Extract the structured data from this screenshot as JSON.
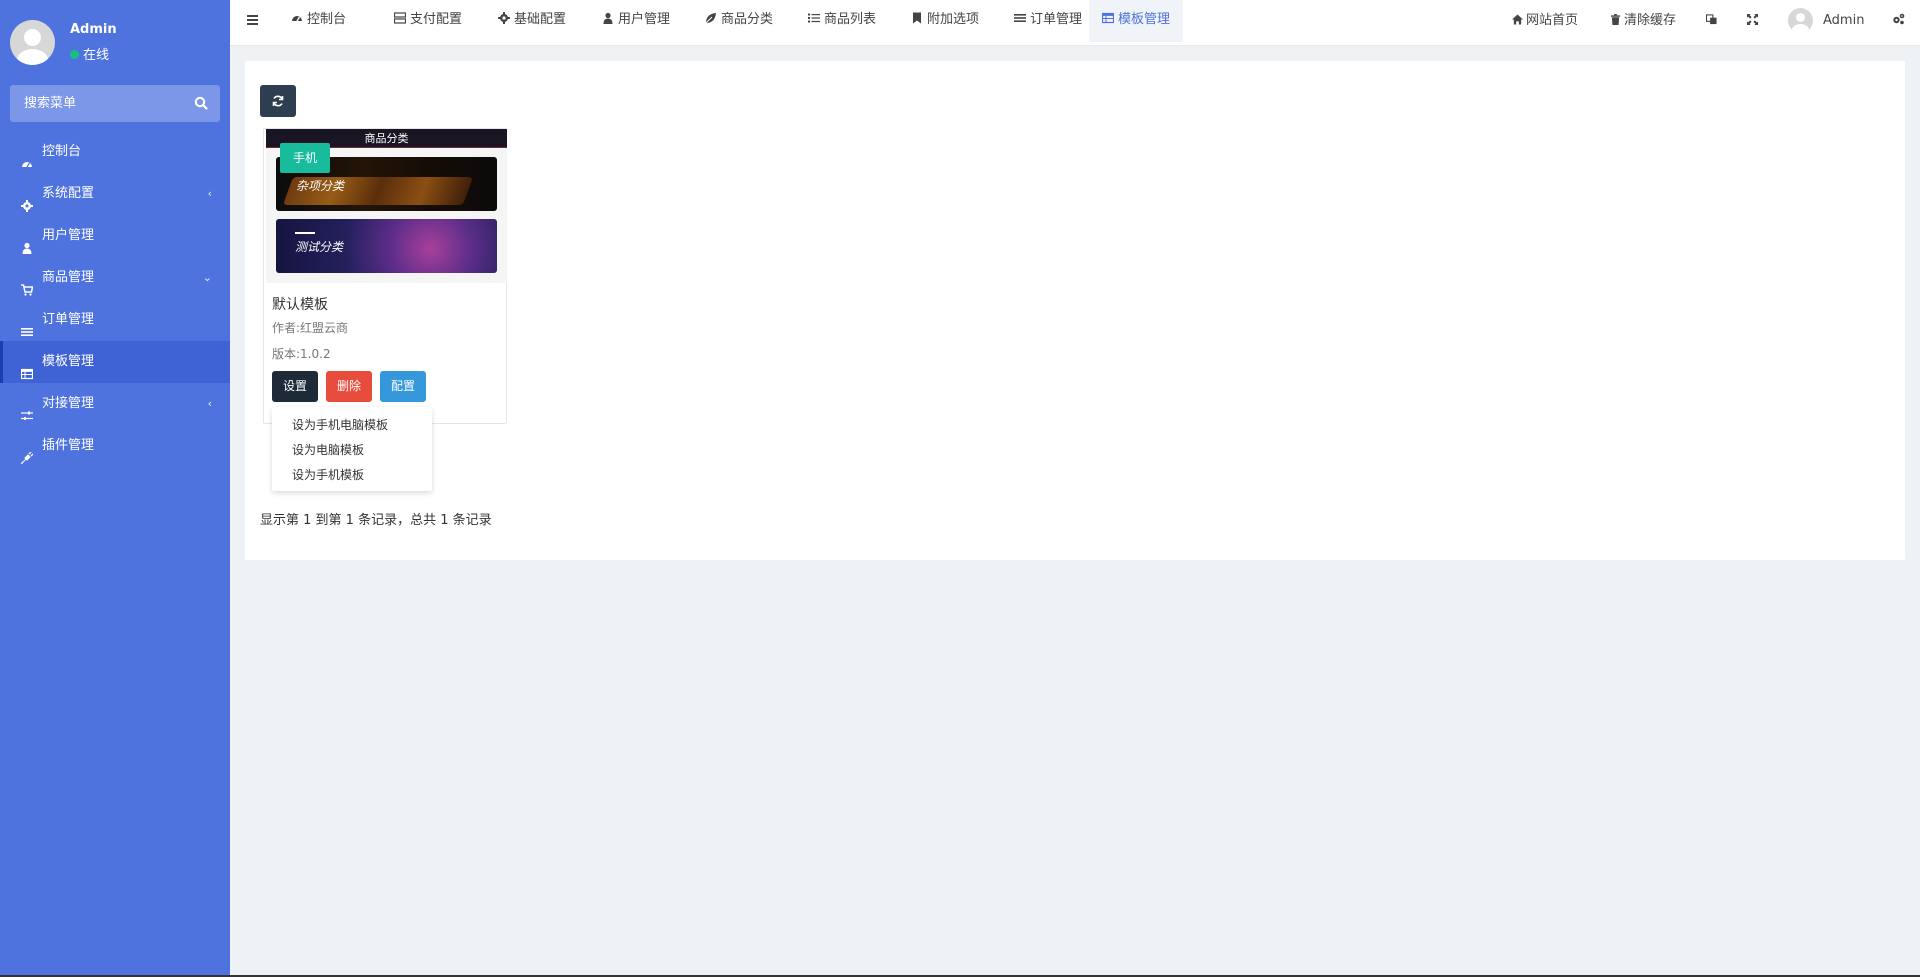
{
  "sidebar": {
    "user": {
      "name": "Admin",
      "status": "在线"
    },
    "search": {
      "placeholder": "搜索菜单"
    },
    "items": [
      {
        "label": "控制台",
        "icon": "dashboard-icon"
      },
      {
        "label": "系统配置",
        "icon": "gear-icon",
        "chevron": "‹"
      },
      {
        "label": "用户管理",
        "icon": "user-icon"
      },
      {
        "label": "商品管理",
        "icon": "cart-icon",
        "chevron": "⌄"
      },
      {
        "label": "订单管理",
        "icon": "list-icon"
      },
      {
        "label": "模板管理",
        "icon": "table-icon",
        "active": true
      },
      {
        "label": "对接管理",
        "icon": "sliders-icon",
        "chevron": "‹"
      },
      {
        "label": "插件管理",
        "icon": "plug-icon"
      }
    ]
  },
  "topnav": {
    "tabs": [
      {
        "label": "控制台",
        "icon": "dashboard-icon"
      },
      {
        "label": "支付配置",
        "icon": "server-icon"
      },
      {
        "label": "基础配置",
        "icon": "gear-icon"
      },
      {
        "label": "用户管理",
        "icon": "user-icon"
      },
      {
        "label": "商品分类",
        "icon": "leaf-icon"
      },
      {
        "label": "商品列表",
        "icon": "list-ul-icon"
      },
      {
        "label": "附加选项",
        "icon": "bookmark-icon"
      },
      {
        "label": "订单管理",
        "icon": "bars-icon"
      },
      {
        "label": "模板管理",
        "icon": "table-icon",
        "active": true
      }
    ],
    "right": {
      "home": "网站首页",
      "clear_cache": "清除缓存",
      "admin": "Admin"
    }
  },
  "content": {
    "card": {
      "thumb_header": "商品分类",
      "banner1_label": "杂项分类",
      "banner2_label": "测试分类",
      "tag": "手机",
      "title": "默认模板",
      "author": "作者:红盟云商",
      "version": "版本:1.0.2",
      "buttons": {
        "settings": "设置",
        "delete": "删除",
        "config": "配置"
      }
    },
    "dropdown": [
      "设为手机电脑模板",
      "设为电脑模板",
      "设为手机模板"
    ],
    "pagination_info": "显示第 1 到第 1 条记录，总共 1 条记录"
  },
  "colors": {
    "sidebar_bg": "#4e73df",
    "accent": "#4e73df",
    "tag": "#18bc9c",
    "delete": "#e74c3c",
    "config": "#3498db",
    "settings": "#1e2a38"
  }
}
